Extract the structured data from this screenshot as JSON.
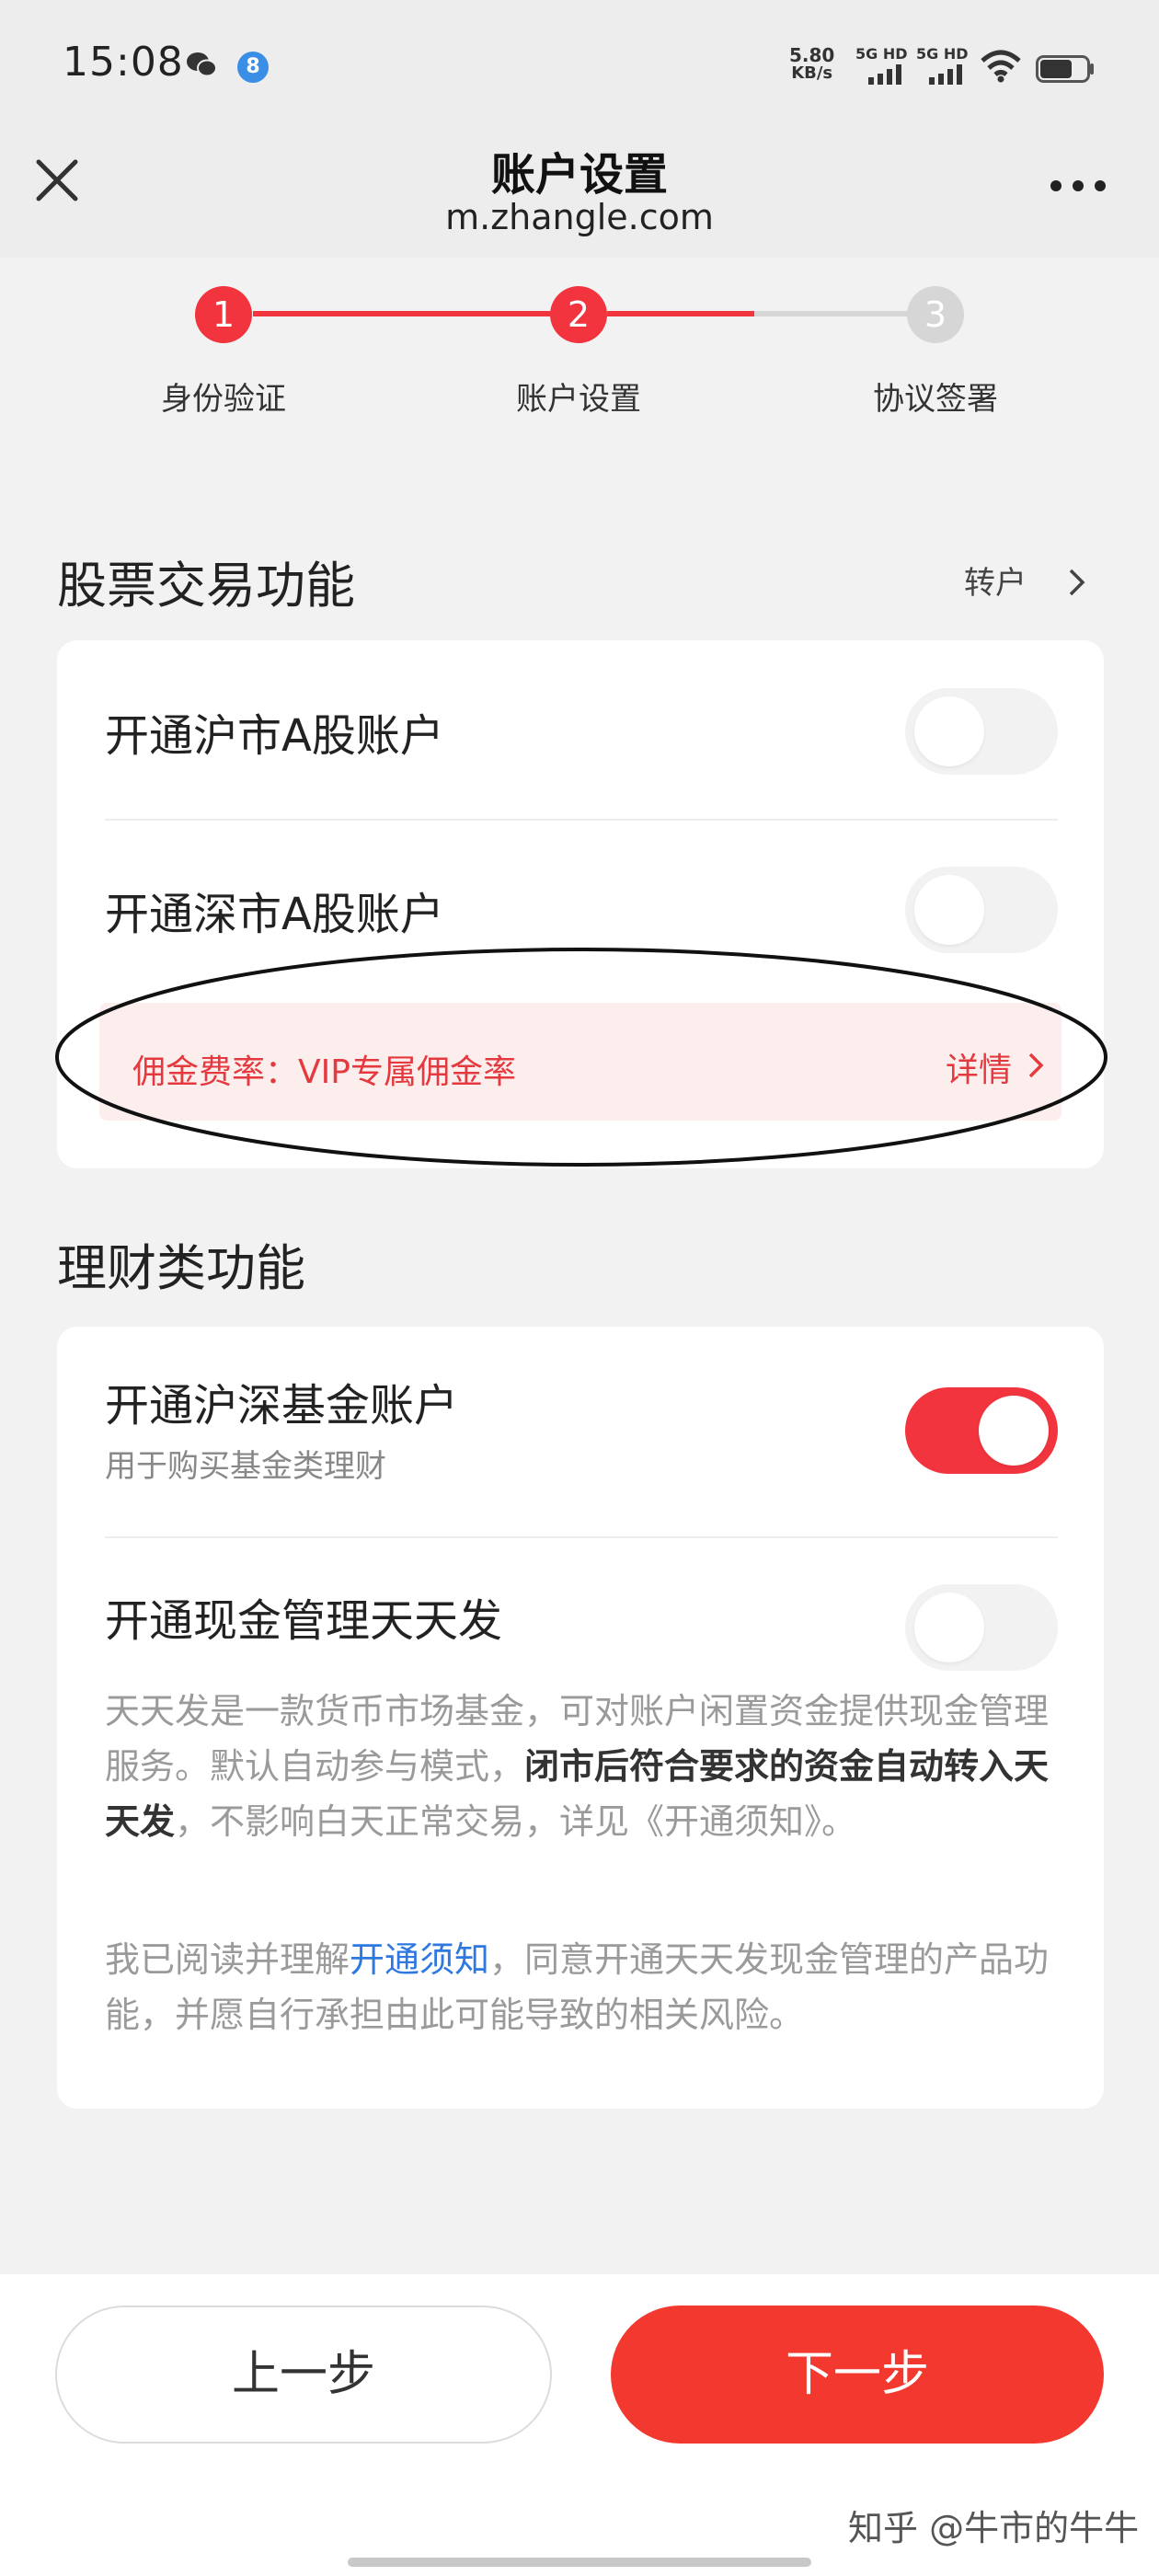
{
  "status_bar": {
    "time": "15:08",
    "badge_count": "8",
    "net_speed_value": "5.80",
    "net_speed_unit": "KB/s",
    "signal_1_label": "5G HD",
    "signal_2_label": "5G HD"
  },
  "header": {
    "title": "账户设置",
    "domain": "m.zhangle.com"
  },
  "stepper": {
    "steps": [
      {
        "number": "1",
        "label": "身份验证"
      },
      {
        "number": "2",
        "label": "账户设置"
      },
      {
        "number": "3",
        "label": "协议签署"
      }
    ],
    "active_color": "#f1343e",
    "inactive_color": "#d6d6d6"
  },
  "stock_section": {
    "title": "股票交易功能",
    "transfer_label": "转户",
    "rows": [
      {
        "label": "开通沪市A股账户",
        "toggle_on": false
      },
      {
        "label": "开通深市A股账户",
        "toggle_on": false
      }
    ],
    "commission_label": "佣金费率：VIP专属佣金率",
    "commission_detail": "详情"
  },
  "finance_section": {
    "title": "理财类功能",
    "fund_row": {
      "label": "开通沪深基金账户",
      "sub": "用于购买基金类理财",
      "toggle_on": true
    },
    "cash_row": {
      "label": "开通现金管理天天发",
      "toggle_on": false
    },
    "desc_part1": "天天发是一款货币市场基金，可对账户闲置资金提供现金管理服务。默认自动参与模式，",
    "desc_bold": "闭市后符合要求的资金自动转入天天发",
    "desc_part2": "，不影响白天正常交易，详见《开通须知》。",
    "agree_part1": "我已阅读并理解",
    "agree_link": "开通须知",
    "agree_part2": "，同意开通天天发现金管理的产品功能，并愿自行承担由此可能导致的相关风险。"
  },
  "footer": {
    "prev_label": "上一步",
    "next_label": "下一步",
    "watermark": "知乎 @牛市的牛牛"
  },
  "colors": {
    "brand_red": "#f2382f",
    "link_blue": "#2e78e0"
  }
}
